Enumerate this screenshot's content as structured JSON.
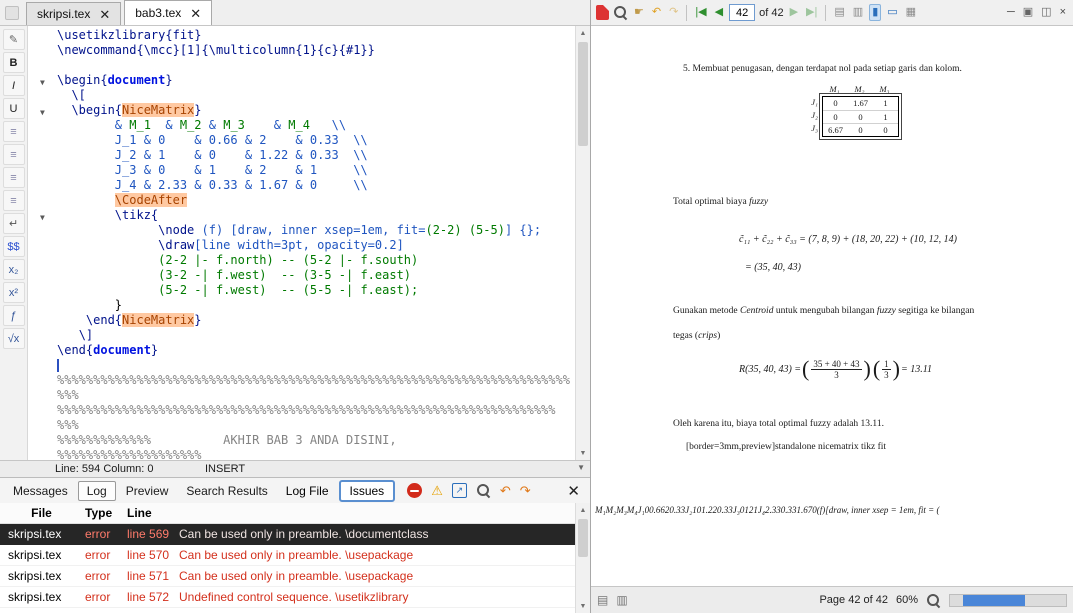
{
  "editor": {
    "tabs": [
      {
        "label": "skripsi.tex",
        "active": false
      },
      {
        "label": "bab3.tex",
        "active": true
      }
    ],
    "side_toolbar": [
      {
        "name": "pencil-icon",
        "glyph": "✎",
        "color": "#666666"
      },
      {
        "name": "bold-button",
        "glyph": "B",
        "color": "#222222",
        "bold": true
      },
      {
        "name": "italic-button",
        "glyph": "I",
        "color": "#222222",
        "italic": true
      },
      {
        "name": "underline-button",
        "glyph": "U",
        "color": "#222222"
      },
      {
        "name": "align-left-button",
        "glyph": "≡",
        "color": "#8888aa"
      },
      {
        "name": "align-center-button",
        "glyph": "≡",
        "color": "#8888aa"
      },
      {
        "name": "align-right-button",
        "glyph": "≡",
        "color": "#8888aa"
      },
      {
        "name": "justify-button",
        "glyph": "≡",
        "color": "#8888aa"
      },
      {
        "name": "newline-button",
        "glyph": "↵",
        "color": "#555555"
      },
      {
        "name": "display-math-button",
        "glyph": "$$",
        "color": "#2a4fd0"
      },
      {
        "name": "subscript-button",
        "glyph": "x₂",
        "color": "#335599"
      },
      {
        "name": "superscript-button",
        "glyph": "x²",
        "color": "#335599"
      },
      {
        "name": "frac-button",
        "glyph": "ƒ",
        "color": "#335599"
      },
      {
        "name": "sqrt-button",
        "glyph": "√x",
        "color": "#335599"
      }
    ],
    "status": {
      "line_col": "Line: 594   Column: 0",
      "mode": "INSERT"
    },
    "code_lines": [
      {
        "fold": false,
        "segs": [
          [
            "cmd",
            "\\usetikzlibrary{fit}"
          ]
        ]
      },
      {
        "fold": false,
        "segs": [
          [
            "cmd",
            "\\newcommand{\\mcc}[1]{\\multicolumn{1}{c}{#1}}"
          ]
        ]
      },
      {
        "fold": false,
        "segs": []
      },
      {
        "fold": true,
        "segs": [
          [
            "cmd",
            "\\begin{"
          ],
          [
            "kw",
            "document"
          ],
          [
            "cmd",
            "}"
          ]
        ]
      },
      {
        "fold": false,
        "segs": [
          [
            "blk",
            "  "
          ],
          [
            "cmd",
            "\\["
          ]
        ]
      },
      {
        "fold": true,
        "segs": [
          [
            "blk",
            "  "
          ],
          [
            "cmd",
            "\\begin{"
          ],
          [
            "hl",
            "NiceMatrix"
          ],
          [
            "cmd",
            "}"
          ]
        ]
      },
      {
        "fold": false,
        "segs": [
          [
            "blk",
            "        "
          ],
          [
            "num",
            "& "
          ],
          [
            "grn",
            "M_1"
          ],
          [
            "num",
            "  & "
          ],
          [
            "grn",
            "M_2"
          ],
          [
            "num",
            " & "
          ],
          [
            "grn",
            "M_3"
          ],
          [
            "num",
            "    & "
          ],
          [
            "grn",
            "M_4"
          ],
          [
            "num",
            "   \\\\"
          ]
        ]
      },
      {
        "fold": false,
        "segs": [
          [
            "blk",
            "        "
          ],
          [
            "num",
            "J_1 & 0    & 0.66 & 2    & 0.33  \\\\"
          ]
        ]
      },
      {
        "fold": false,
        "segs": [
          [
            "blk",
            "        "
          ],
          [
            "num",
            "J_2 & 1    & 0    & 1.22 & 0.33  \\\\"
          ]
        ]
      },
      {
        "fold": false,
        "segs": [
          [
            "blk",
            "        "
          ],
          [
            "num",
            "J_3 & 0    & 1    & 2    & 1     \\\\"
          ]
        ]
      },
      {
        "fold": false,
        "segs": [
          [
            "blk",
            "        "
          ],
          [
            "num",
            "J_4 & 2.33 & 0.33 & 1.67 & 0     \\\\"
          ]
        ]
      },
      {
        "fold": false,
        "segs": [
          [
            "blk",
            "        "
          ],
          [
            "hl",
            "\\CodeAfter"
          ]
        ]
      },
      {
        "fold": true,
        "segs": [
          [
            "blk",
            "        "
          ],
          [
            "cmd",
            "\\tikz{"
          ]
        ]
      },
      {
        "fold": false,
        "segs": [
          [
            "blk",
            "              "
          ],
          [
            "cmd",
            "\\node"
          ],
          [
            "num",
            " (f) [draw, inner xsep=1em, fit="
          ],
          [
            "grn",
            "(2-2) (5-5)"
          ],
          [
            "num",
            "] {};"
          ]
        ]
      },
      {
        "fold": false,
        "segs": [
          [
            "blk",
            "              "
          ],
          [
            "cmd",
            "\\draw"
          ],
          [
            "num",
            "[line width=3pt, opacity=0.2]"
          ]
        ]
      },
      {
        "fold": false,
        "segs": [
          [
            "blk",
            "              "
          ],
          [
            "grn",
            "(2-2 |- f.north) -- (5-2 |- f.south)"
          ]
        ]
      },
      {
        "fold": false,
        "segs": [
          [
            "blk",
            "              "
          ],
          [
            "grn",
            "(3-2 -| f.west)  -- (3-5 -| f.east)"
          ]
        ]
      },
      {
        "fold": false,
        "segs": [
          [
            "blk",
            "              "
          ],
          [
            "grn",
            "(5-2 -| f.west)  -- (5-5 -| f.east);"
          ]
        ]
      },
      {
        "fold": false,
        "segs": [
          [
            "blk",
            "        }"
          ]
        ]
      },
      {
        "fold": false,
        "segs": [
          [
            "blk",
            "    "
          ],
          [
            "cmd",
            "\\end{"
          ],
          [
            "hl",
            "NiceMatrix"
          ],
          [
            "cmd",
            "}"
          ]
        ]
      },
      {
        "fold": false,
        "segs": [
          [
            "blk",
            "   "
          ],
          [
            "cmd",
            "\\]"
          ]
        ]
      },
      {
        "fold": false,
        "segs": [
          [
            "cmd",
            "\\end{"
          ],
          [
            "kw",
            "document"
          ],
          [
            "cmd",
            "}"
          ]
        ]
      },
      {
        "fold": false,
        "segs": []
      },
      {
        "fold": false,
        "segs": [
          [
            "com",
            "%%%%%%%%%%%%%%%%%%%%%%%%%%%%%%%%%%%%%%%%%%%%%%%%%%%%%%%%%%%%%%%%%%%%%%%"
          ]
        ]
      },
      {
        "fold": false,
        "segs": [
          [
            "com",
            "%%%"
          ]
        ]
      },
      {
        "fold": false,
        "segs": [
          [
            "com",
            "%%%%%%%%%%%%%%%%%%%%%%%%%%%%%%%%%%%%%%%%%%%%%%%%%%%%%%%%%%%%%%%%%%%%%"
          ]
        ]
      },
      {
        "fold": false,
        "segs": [
          [
            "com",
            "%%%"
          ]
        ]
      },
      {
        "fold": false,
        "segs": [
          [
            "com",
            "%%%%%%%%%%%%%          AKHIR BAB 3 ANDA DISINI,"
          ]
        ]
      },
      {
        "fold": false,
        "segs": [
          [
            "com",
            "%%%%%%%%%%%%%%%%%%%%"
          ]
        ]
      }
    ]
  },
  "log_panel": {
    "tabs": [
      {
        "label": "Messages",
        "active": false
      },
      {
        "label": "Log",
        "active": true
      },
      {
        "label": "Preview",
        "active": false
      },
      {
        "label": "Search Results",
        "active": false
      }
    ],
    "log_file_label": "Log File",
    "issues_label": "Issues",
    "icons": [
      {
        "name": "stop-icon",
        "kind": "stop"
      },
      {
        "name": "warning-icon",
        "kind": "glyph",
        "glyph": "⚠",
        "color": "#e5a000"
      },
      {
        "name": "external-view-icon",
        "kind": "boxarrow"
      },
      {
        "name": "find-options-icon",
        "kind": "mag"
      },
      {
        "name": "prev-error-icon",
        "kind": "glyph",
        "glyph": "↶",
        "color": "#e07818"
      },
      {
        "name": "next-error-icon",
        "kind": "glyph",
        "glyph": "↷",
        "color": "#e07818"
      }
    ],
    "columns": [
      "File",
      "Type",
      "Line"
    ],
    "rows": [
      {
        "file": "skripsi.tex",
        "type": "error",
        "line": "line 569",
        "message": "Can be used only in preamble.  \\documentclass",
        "selected": true
      },
      {
        "file": "skripsi.tex",
        "type": "error",
        "line": "line 570",
        "message": "Can be used only in preamble.  \\usepackage",
        "selected": false
      },
      {
        "file": "skripsi.tex",
        "type": "error",
        "line": "line 571",
        "message": "Can be used only in preamble.  \\usepackage",
        "selected": false
      },
      {
        "file": "skripsi.tex",
        "type": "error",
        "line": "line 572",
        "message": "Undefined control sequence.  \\usetikzlibrary",
        "selected": false
      }
    ]
  },
  "pdf": {
    "toolbar": {
      "page_value": "42",
      "page_of": "of 42",
      "items": [
        {
          "type": "pdf",
          "name": "pdf-logo-icon"
        },
        {
          "type": "mag",
          "name": "search-icon"
        },
        {
          "type": "glyph",
          "name": "hand-tool-icon",
          "glyph": "☛",
          "color": "#c09a4a"
        },
        {
          "type": "glyph",
          "name": "history-back-icon",
          "glyph": "↶",
          "color": "#e0a020"
        },
        {
          "type": "glyph",
          "name": "history-forward-icon",
          "glyph": "↷",
          "color": "#dfc488"
        },
        {
          "type": "sep"
        },
        {
          "type": "glyph",
          "name": "first-page-icon",
          "glyph": "|◀",
          "color": "#2f8f2f"
        },
        {
          "type": "glyph",
          "name": "prev-page-icon",
          "glyph": "◀",
          "color": "#2f8f2f"
        },
        {
          "type": "input",
          "name": "page-number-input"
        },
        {
          "type": "pagecount",
          "name": "page-count-label"
        },
        {
          "type": "glyph",
          "name": "next-page-icon",
          "glyph": "▶",
          "color": "#9dc59d"
        },
        {
          "type": "glyph",
          "name": "last-page-icon",
          "glyph": "▶|",
          "color": "#9dc59d"
        },
        {
          "type": "sep"
        },
        {
          "type": "glyph",
          "name": "fit-width-icon",
          "glyph": "▤",
          "color": "#8a8a8a"
        },
        {
          "type": "glyph",
          "name": "fit-page-icon",
          "glyph": "▥",
          "color": "#8a8a8a"
        },
        {
          "type": "glyph",
          "name": "text-select-icon",
          "glyph": "▮",
          "color": "#2a6ebb",
          "highlight": true
        },
        {
          "type": "glyph",
          "name": "area-select-icon",
          "glyph": "▭",
          "color": "#2a6ebb"
        },
        {
          "type": "glyph",
          "name": "print-icon",
          "glyph": "▦",
          "color": "#8a8a8a"
        },
        {
          "type": "spacer"
        },
        {
          "type": "glyph",
          "name": "minimize-view-icon",
          "glyph": "─",
          "color": "#444444"
        },
        {
          "type": "glyph",
          "name": "single-page-icon",
          "glyph": "▣",
          "color": "#666666"
        },
        {
          "type": "glyph",
          "name": "two-page-icon",
          "glyph": "◫",
          "color": "#666666"
        },
        {
          "type": "glyph",
          "name": "close-viewer-icon",
          "glyph": "×",
          "color": "#444444"
        }
      ]
    },
    "page": {
      "item5": "5. Membuat penugasan, dengan terdapat nol pada setiap garis dan kolom.",
      "matrix": {
        "col_headers": [
          "M₁",
          "M₂",
          "M₃"
        ],
        "row_headers": [
          "J₁",
          "J₂",
          "J₃"
        ],
        "values": [
          [
            "0",
            "1.67",
            "1"
          ],
          [
            "0",
            "0",
            "1"
          ],
          [
            "6.67",
            "0",
            "0"
          ]
        ]
      },
      "total_segs": [
        [
          "rm",
          "Total optimal biaya "
        ],
        [
          "it",
          "fuzzy"
        ]
      ],
      "eq1a": "c̃₁₁ + c̃₂₂ + c̃₃₃ = (7, 8, 9) + (18, 20, 22) + (10, 12, 14)",
      "eq1b": "= (35, 40, 43)",
      "para1_segs": [
        [
          "rm",
          "Gunakan metode "
        ],
        [
          "it",
          "Centroid"
        ],
        [
          "rm",
          " untuk mengubah bilangan "
        ],
        [
          "it",
          "fuzzy"
        ],
        [
          "rm",
          " segitiga ke bilangan"
        ]
      ],
      "para1b_segs": [
        [
          "rm",
          "tegas ("
        ],
        [
          "it",
          "crips"
        ],
        [
          "rm",
          ")"
        ]
      ],
      "eq2": {
        "pre": "R(35, 40, 43) = ",
        "f1n": "35 + 40 + 43",
        "f1d": "3",
        "f2n": "1",
        "f2d": "3",
        "post": " = 13.11"
      },
      "para2": "Oleh karena itu, biaya total optimal fuzzy adalah 13.11.",
      "para3": "[border=3mm,preview]standalone nicematrix tikz fit",
      "bottom_math": "M₁M₂M₃M₄J₁00.6620.33J₂101.220.33J₃0121J₄2.330.331.670(f)[draw, inner xsep = 1em, fit = ("
    },
    "status": {
      "page_label": "Page 42 of 42",
      "zoom": "60%"
    }
  }
}
